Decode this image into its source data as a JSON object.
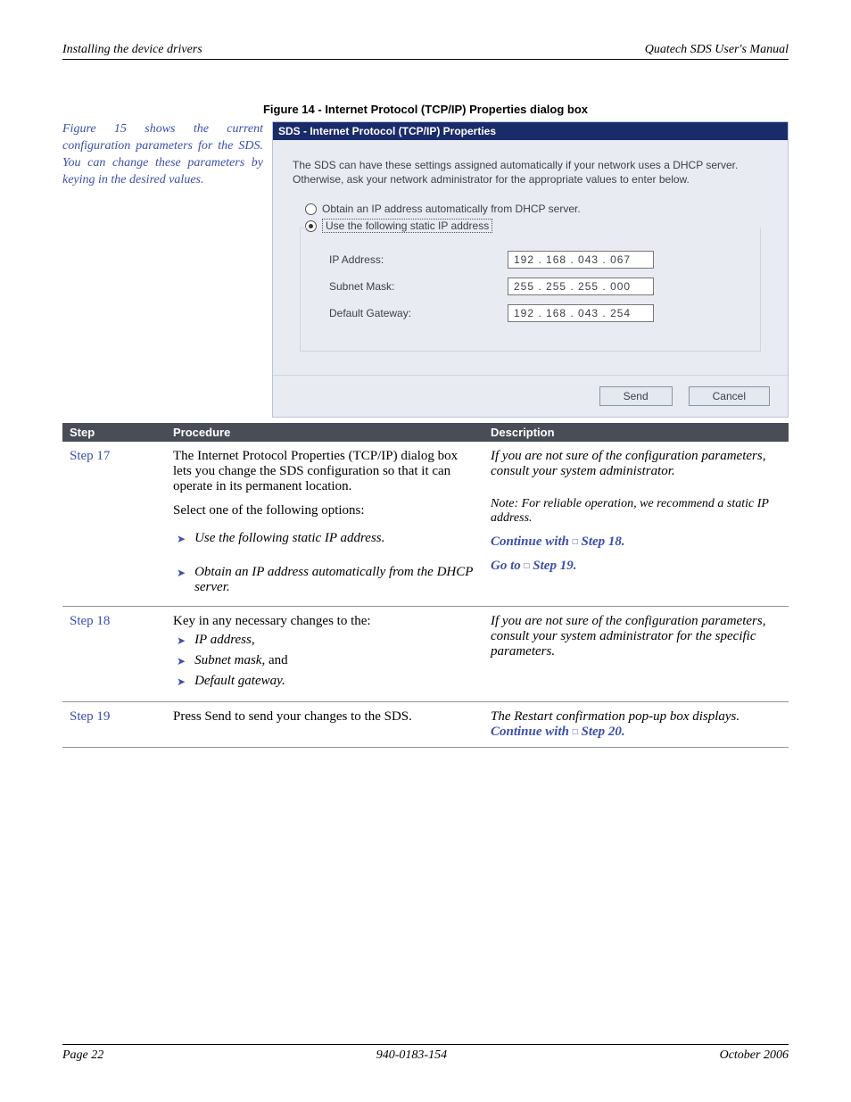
{
  "header": {
    "left": "Installing the device drivers",
    "right": "Quatech SDS User's Manual"
  },
  "caption": "Figure 14 - Internet Protocol (TCP/IP) Properties dialog box",
  "sidenote": "Figure 15 shows the current configuration parameters for the SDS. You can change these parameters by keying in the desired values.",
  "dialog": {
    "title": "SDS - Internet Protocol (TCP/IP) Properties",
    "intro": "The SDS can have these settings assigned automatically if your network uses a DHCP server. Otherwise, ask your network administrator for the appropriate values to enter below.",
    "radio1": "Obtain an IP address automatically from DHCP server.",
    "radio2": "Use the following static IP address",
    "fields": {
      "ip_label": "IP Address:",
      "ip_value": "192 . 168 . 043 . 067",
      "mask_label": "Subnet Mask:",
      "mask_value": "255 . 255 . 255 . 000",
      "gw_label": "Default Gateway:",
      "gw_value": "192 . 168 . 043 . 254"
    },
    "send": "Send",
    "cancel": "Cancel"
  },
  "table": {
    "headers": {
      "step": "Step",
      "proc": "Procedure",
      "desc": "Description"
    },
    "rows": {
      "r17": {
        "step": "Step 17",
        "proc_p1": "The Internet Protocol Properties (TCP/IP) dialog box lets you change the SDS configuration so that it can operate in its permanent location.",
        "proc_p2": "Select one of the following options:",
        "proc_b1": "Use the following static IP address.",
        "proc_b2": "Obtain an IP address automatically from the DHCP server.",
        "desc_p1": "If you are not sure of the configuration parameters, consult your system administrator.",
        "desc_note": "Note: For reliable operation, we recommend a static IP address.",
        "desc_c1a": "Continue with ",
        "desc_c1b": " Step 18.",
        "desc_c2a": "Go to ",
        "desc_c2b": " Step 19."
      },
      "r18": {
        "step": "Step 18",
        "proc_p1": "Key in any necessary changes to the:",
        "b1": "IP address,",
        "b2": "Subnet mask,",
        "b2_suffix": " and",
        "b3": "Default gateway.",
        "desc": "If you are not sure of the configuration parameters, consult your system administrator for the specific parameters."
      },
      "r19": {
        "step": "Step 19",
        "proc": "Press Send to send your changes to the SDS.",
        "desc1": "The Restart confirmation pop-up box displays.",
        "desc2a": "Continue with ",
        "desc2b": " Step 20."
      }
    }
  },
  "footer": {
    "left": "Page 22",
    "center": "940-0183-154",
    "right": "October 2006"
  }
}
